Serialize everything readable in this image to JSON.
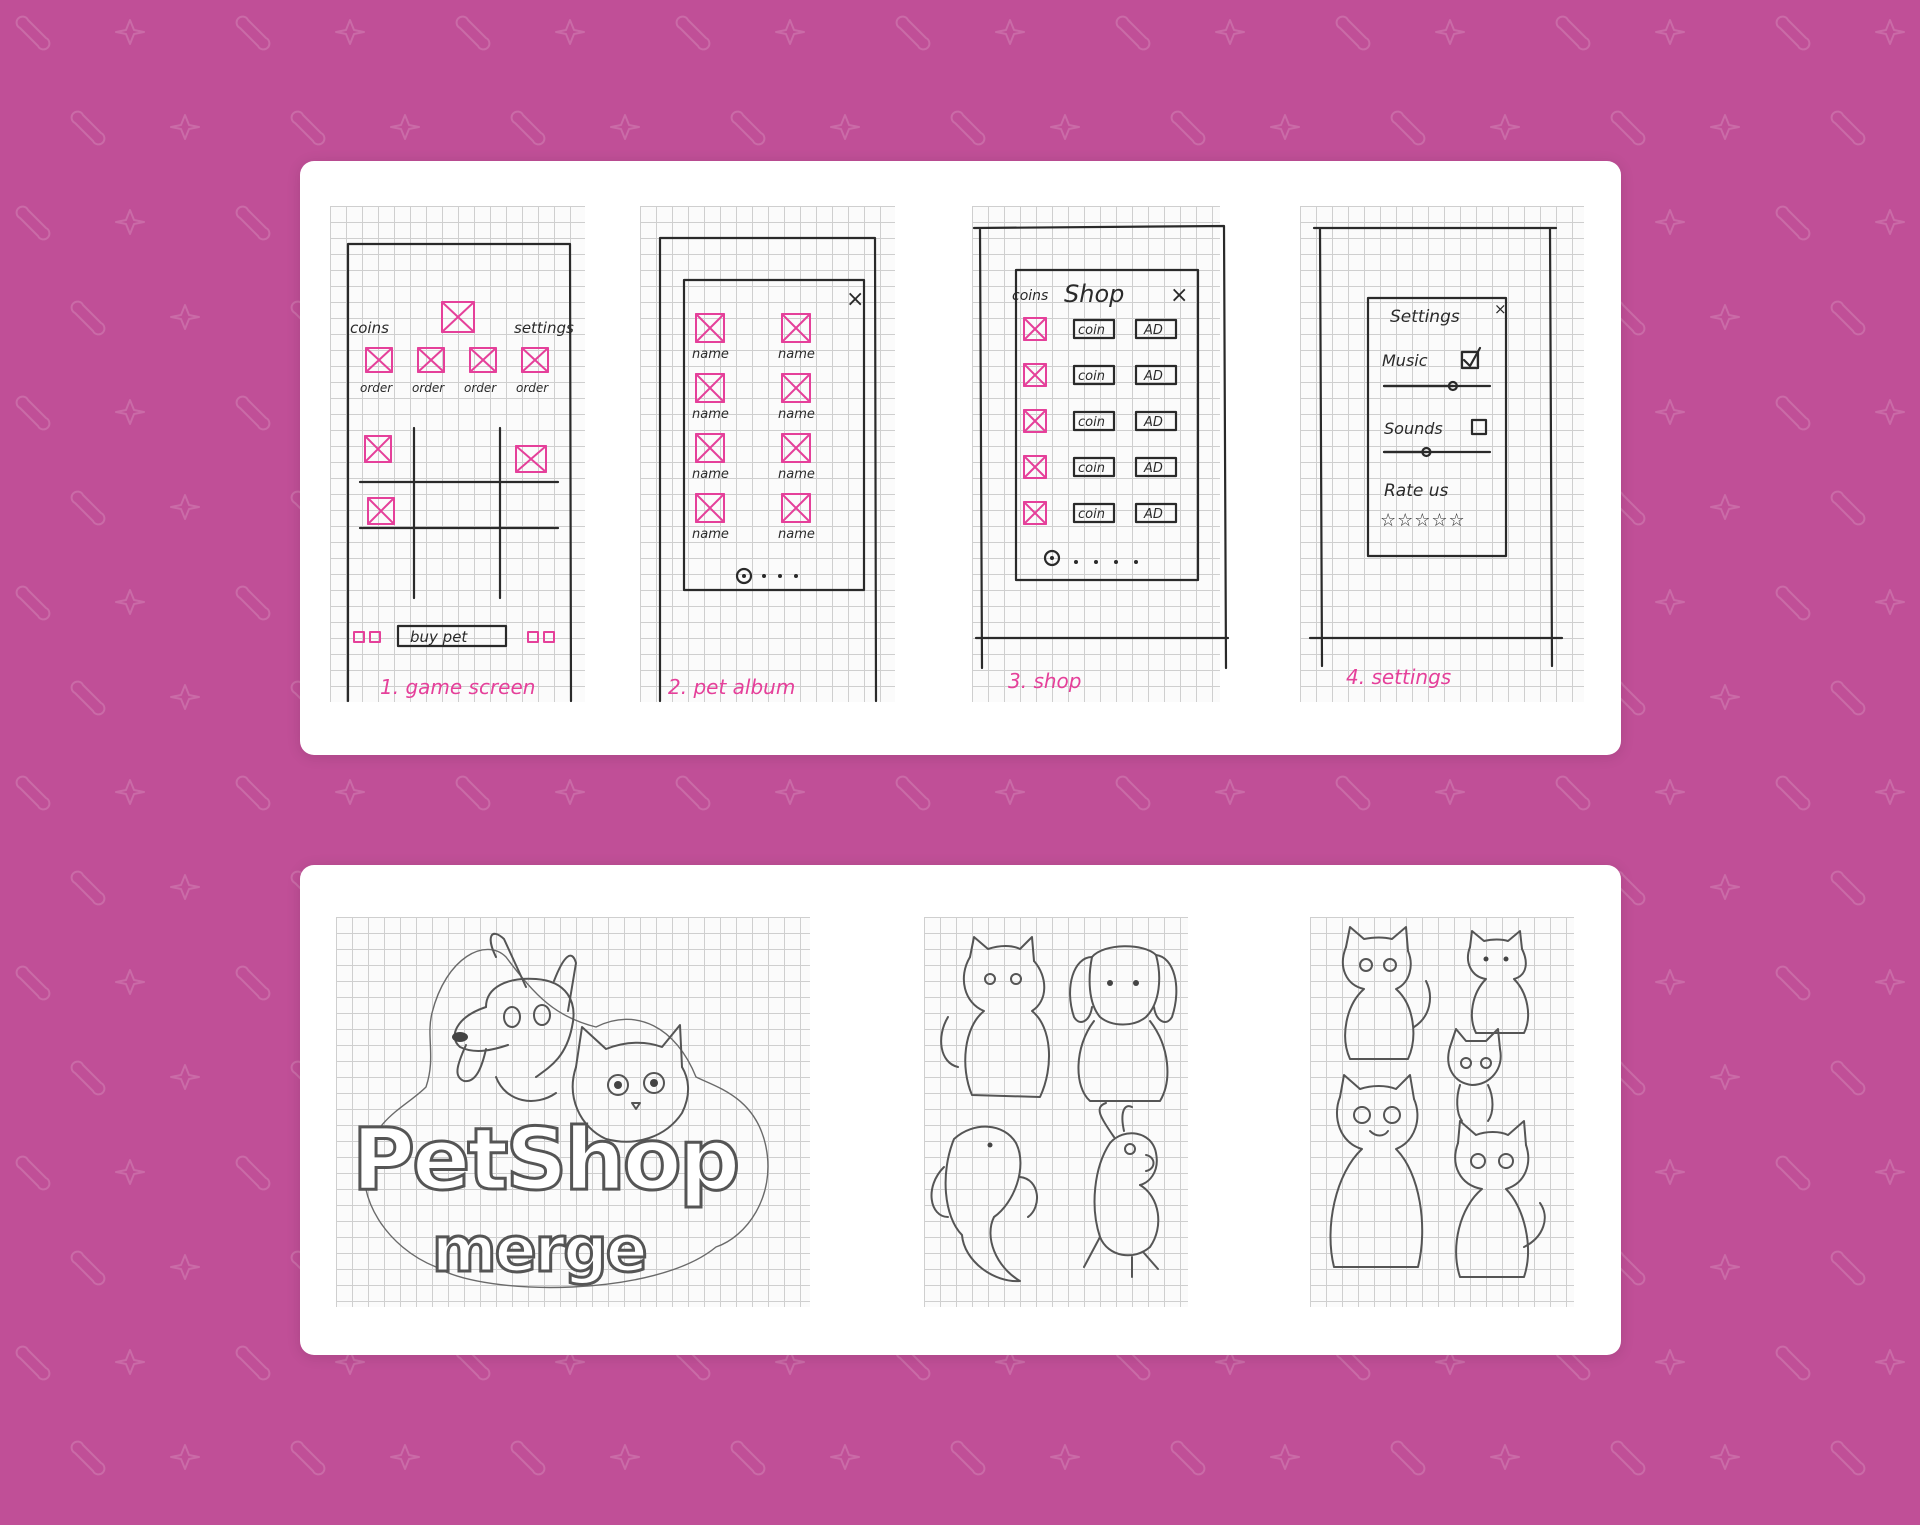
{
  "wireframes": [
    {
      "caption": "1. game screen",
      "coins": "coins",
      "settings": "settings",
      "order_labels": [
        "order",
        "order",
        "order",
        "order"
      ],
      "buy_button": "buy pet"
    },
    {
      "caption": "2. pet album",
      "close": "×",
      "pet_labels": [
        "name",
        "name",
        "name",
        "name",
        "name",
        "name",
        "name",
        "name"
      ]
    },
    {
      "caption": "3. shop",
      "coins": "coins",
      "title": "Shop",
      "close": "×",
      "rows": [
        {
          "coin": "coin",
          "ad": "AD"
        },
        {
          "coin": "coin",
          "ad": "AD"
        },
        {
          "coin": "coin",
          "ad": "AD"
        },
        {
          "coin": "coin",
          "ad": "AD"
        },
        {
          "coin": "coin",
          "ad": "AD"
        }
      ]
    },
    {
      "caption": "4. settings",
      "title": "Settings",
      "close": "×",
      "music_label": "Music",
      "music_checked": true,
      "music_level": 0.65,
      "sounds_label": "Sounds",
      "sounds_checked": false,
      "sounds_level": 0.4,
      "rate_label": "Rate us",
      "stars": "☆☆☆☆☆"
    }
  ],
  "logo": {
    "line1": "PetShop",
    "line2": "merge"
  },
  "colors": {
    "background": "#c04f97",
    "pink_ink": "#e5409a",
    "pencil": "#555555"
  }
}
